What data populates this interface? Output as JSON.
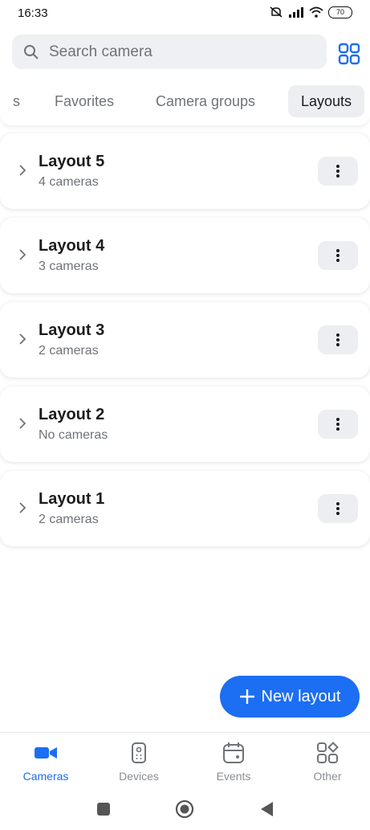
{
  "status_bar": {
    "time": "16:33",
    "battery": "70"
  },
  "search": {
    "placeholder": "Search camera"
  },
  "tabs": [
    {
      "label": "s"
    },
    {
      "label": "Favorites"
    },
    {
      "label": "Camera groups"
    },
    {
      "label": "Layouts"
    }
  ],
  "layouts": [
    {
      "title": "Layout 5",
      "subtitle": "4 cameras"
    },
    {
      "title": "Layout 4",
      "subtitle": "3 cameras"
    },
    {
      "title": "Layout 3",
      "subtitle": "2 cameras"
    },
    {
      "title": "Layout 2",
      "subtitle": "No cameras"
    },
    {
      "title": "Layout 1",
      "subtitle": "2 cameras"
    }
  ],
  "fab": {
    "label": "New layout"
  },
  "bottom_nav": [
    {
      "label": "Cameras",
      "icon": "video-camera-icon"
    },
    {
      "label": "Devices",
      "icon": "device-icon"
    },
    {
      "label": "Events",
      "icon": "calendar-icon"
    },
    {
      "label": "Other",
      "icon": "apps-icon"
    }
  ],
  "colors": {
    "accent": "#1c6ef2",
    "muted": "#6f7378",
    "chip_bg": "#eceef1"
  }
}
